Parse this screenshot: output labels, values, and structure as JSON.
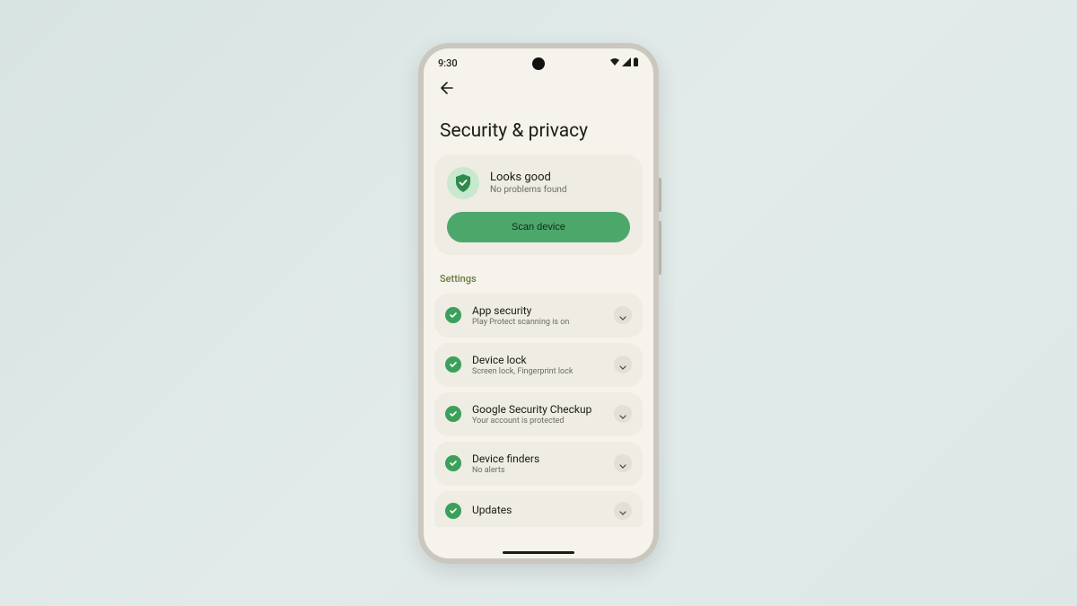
{
  "status_bar": {
    "time": "9:30"
  },
  "page": {
    "title": "Security & privacy"
  },
  "status_card": {
    "title": "Looks good",
    "subtitle": "No problems found",
    "button": "Scan device"
  },
  "section_label": "Settings",
  "items": [
    {
      "title": "App security",
      "subtitle": "Play Protect scanning is on"
    },
    {
      "title": "Device lock",
      "subtitle": "Screen lock, Fingerprint lock"
    },
    {
      "title": "Google Security Checkup",
      "subtitle": "Your account is protected"
    },
    {
      "title": "Device finders",
      "subtitle": "No alerts"
    },
    {
      "title": "Updates",
      "subtitle": ""
    }
  ],
  "colors": {
    "accent_green": "#4ca76a",
    "check_green": "#3ba05a",
    "background": "#f5f3eb",
    "card": "#eeece3"
  }
}
